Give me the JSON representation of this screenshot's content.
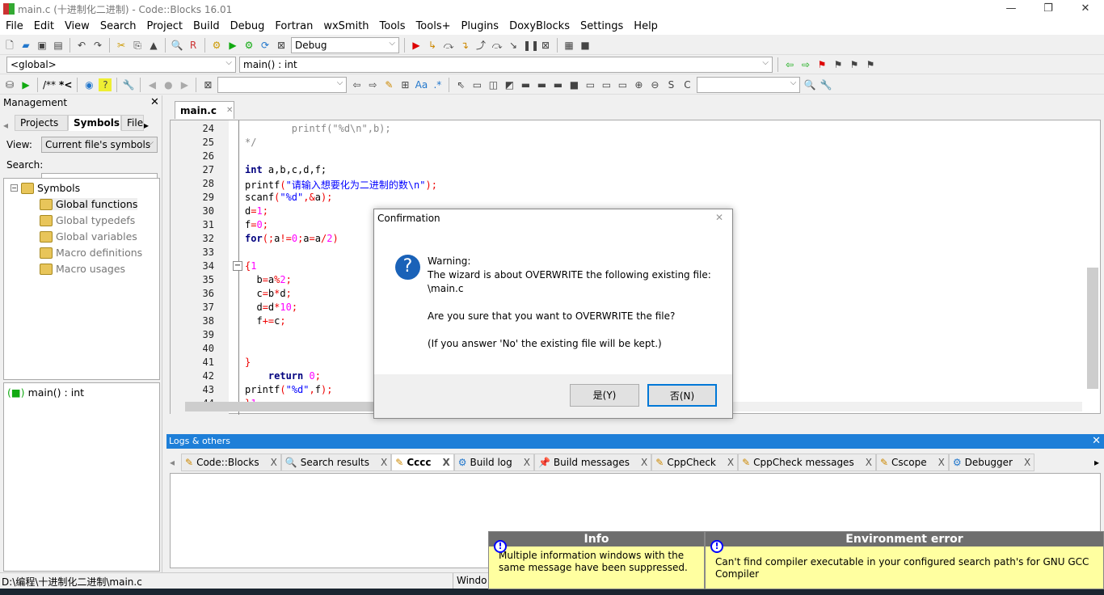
{
  "window": {
    "title": "main.c (十进制化二进制) - Code::Blocks 16.01",
    "minimize": "—",
    "restore": "❐",
    "close": "✕"
  },
  "menu": [
    "File",
    "Edit",
    "View",
    "Search",
    "Project",
    "Build",
    "Debug",
    "Fortran",
    "wxSmith",
    "Tools",
    "Tools+",
    "Plugins",
    "DoxyBlocks",
    "Settings",
    "Help"
  ],
  "toolbar": {
    "build_target": "Debug",
    "scope": "<global>",
    "function": "main() : int",
    "comment_block": "/**",
    "comment_line": "*<"
  },
  "management": {
    "title": "Management",
    "close": "✕",
    "tabs": [
      "Projects",
      "Symbols",
      "Files"
    ],
    "view_label": "View:",
    "view_value": "Current file's symbols",
    "search_label": "Search:",
    "search_value": "",
    "tree": {
      "root": "Symbols",
      "children": [
        "Global functions",
        "Global typedefs",
        "Global variables",
        "Macro definitions",
        "Macro usages"
      ]
    },
    "detail": "main() : int"
  },
  "editor": {
    "tab": "main.c",
    "tab_close": "✕",
    "lines": [
      {
        "n": "24",
        "t": [
          [
            "        printf(\"%d\\n\",b);",
            "c"
          ]
        ]
      },
      {
        "n": "25",
        "t": [
          [
            "*/",
            "c"
          ]
        ]
      },
      {
        "n": "26",
        "t": []
      },
      {
        "n": "27",
        "t": [
          [
            "int",
            "k"
          ],
          [
            " a,b,c,d,f;",
            "p"
          ]
        ]
      },
      {
        "n": "28",
        "t": [
          [
            "printf",
            "p"
          ],
          [
            "(",
            "o"
          ],
          [
            "\"请输入想要化为二进制的数\\n\"",
            "s"
          ],
          [
            ");",
            "o"
          ]
        ]
      },
      {
        "n": "29",
        "t": [
          [
            "scanf",
            "p"
          ],
          [
            "(",
            "o"
          ],
          [
            "\"%d\"",
            "s"
          ],
          [
            ",&",
            "o"
          ],
          [
            "a",
            ""
          ],
          [
            ");",
            "o"
          ]
        ]
      },
      {
        "n": "30",
        "t": [
          [
            "d",
            "p"
          ],
          [
            "=",
            "o"
          ],
          [
            "1",
            "n"
          ],
          [
            ";",
            "o"
          ]
        ]
      },
      {
        "n": "31",
        "t": [
          [
            "f",
            "p"
          ],
          [
            "=",
            "o"
          ],
          [
            "0",
            "n"
          ],
          [
            ";",
            "o"
          ]
        ]
      },
      {
        "n": "32",
        "t": [
          [
            "for",
            "k"
          ],
          [
            "(;",
            "o"
          ],
          [
            "a",
            "p"
          ],
          [
            "!=",
            "o"
          ],
          [
            "0",
            "n"
          ],
          [
            ";",
            "o"
          ],
          [
            "a",
            "p"
          ],
          [
            "=",
            "o"
          ],
          [
            "a",
            "p"
          ],
          [
            "/",
            "o"
          ],
          [
            "2",
            "n"
          ],
          [
            ")",
            "o"
          ]
        ]
      },
      {
        "n": "33",
        "t": []
      },
      {
        "n": "34",
        "t": [
          [
            "{",
            "o"
          ],
          [
            "1",
            "n"
          ]
        ]
      },
      {
        "n": "35",
        "t": [
          [
            "  b",
            "p"
          ],
          [
            "=",
            "o"
          ],
          [
            "a",
            "p"
          ],
          [
            "%",
            "o"
          ],
          [
            "2",
            "n"
          ],
          [
            ";",
            "o"
          ]
        ]
      },
      {
        "n": "36",
        "t": [
          [
            "  c",
            "p"
          ],
          [
            "=",
            "o"
          ],
          [
            "b",
            "p"
          ],
          [
            "*",
            "o"
          ],
          [
            "d",
            "p"
          ],
          [
            ";",
            "o"
          ]
        ]
      },
      {
        "n": "37",
        "t": [
          [
            "  d",
            "p"
          ],
          [
            "=",
            "o"
          ],
          [
            "d",
            "p"
          ],
          [
            "*",
            "o"
          ],
          [
            "10",
            "n"
          ],
          [
            ";",
            "o"
          ]
        ]
      },
      {
        "n": "38",
        "t": [
          [
            "  f",
            "p"
          ],
          [
            "+=",
            "o"
          ],
          [
            "c",
            "p"
          ],
          [
            ";",
            "o"
          ]
        ]
      },
      {
        "n": "39",
        "t": []
      },
      {
        "n": "40",
        "t": []
      },
      {
        "n": "41",
        "t": [
          [
            "}",
            "o"
          ]
        ]
      },
      {
        "n": "42",
        "t": [
          [
            "    return",
            "k"
          ],
          [
            " ",
            "p"
          ],
          [
            "0",
            "n"
          ],
          [
            ";",
            "o"
          ]
        ]
      },
      {
        "n": "43",
        "t": [
          [
            "printf",
            "p"
          ],
          [
            "(",
            "o"
          ],
          [
            "\"%d\"",
            "s"
          ],
          [
            ",",
            "o"
          ],
          [
            "f",
            "p"
          ],
          [
            ");",
            "o"
          ]
        ]
      },
      {
        "n": "44",
        "t": [
          [
            "}",
            "o"
          ],
          [
            "1",
            "n"
          ]
        ]
      }
    ]
  },
  "dialog": {
    "title": "Confirmation",
    "close": "✕",
    "icon": "question-icon",
    "warning": "Warning:",
    "line1": "The wizard is about OVERWRITE the following existing file:",
    "file": "\\main.c",
    "question": "Are you sure that you want to OVERWRITE the file?",
    "note": "(If you answer 'No' the existing file will be kept.)",
    "yes": "是(Y)",
    "no": "否(N)"
  },
  "logs": {
    "title": "Logs & others",
    "close": "✕",
    "tabs": [
      "Code::Blocks",
      "Search results",
      "Cccc",
      "Build log",
      "Build messages",
      "CppCheck",
      "CppCheck messages",
      "Cscope",
      "Debugger"
    ],
    "tab_close": "X"
  },
  "popups": [
    {
      "title": "Info",
      "text": "Multiple information windows with the same message have been suppressed."
    },
    {
      "title": "Environment error",
      "text": "Can't find compiler executable in your configured search path's for GNU GCC Compiler"
    }
  ],
  "status": {
    "path": "D:\\编程\\十进制化二进制\\main.c",
    "line_ending": "Windo"
  }
}
